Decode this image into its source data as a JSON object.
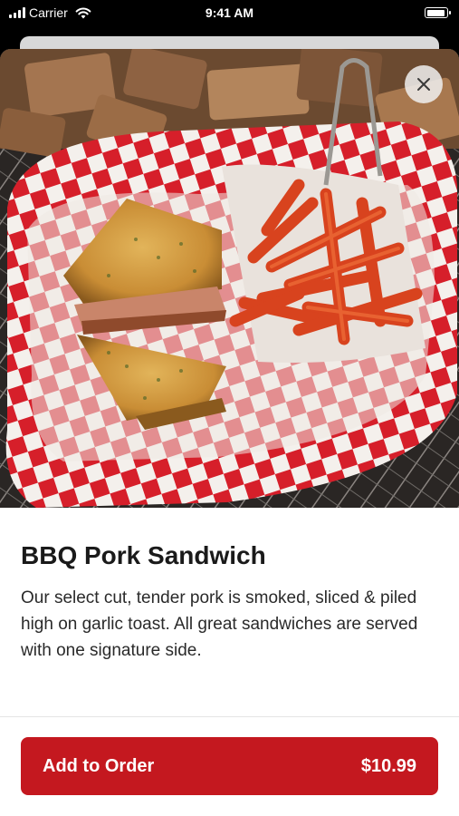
{
  "status_bar": {
    "carrier": "Carrier",
    "time": "9:41 AM",
    "signal_icon": "cellular-signal-icon",
    "wifi_icon": "wifi-icon",
    "battery_icon": "battery-icon"
  },
  "item": {
    "image_alt": "BBQ pork sandwich on garlic toast with crinkle fries in a checkered-paper basket",
    "name": "BBQ Pork Sandwich",
    "description": "Our select cut, tender pork is smoked, sliced & piled high on garlic toast. All great sandwiches are served with one signature side."
  },
  "actions": {
    "close_icon": "close-icon",
    "add_label": "Add to Order",
    "price": "$10.99"
  },
  "colors": {
    "accent": "#c4181f",
    "background": "#ffffff",
    "text": "#1a1a1a"
  }
}
